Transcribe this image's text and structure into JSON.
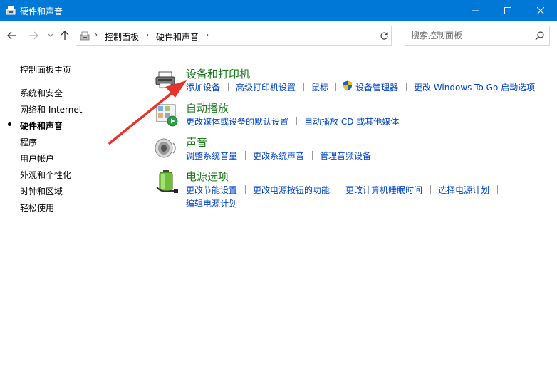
{
  "window": {
    "title": "硬件和声音",
    "controls": {
      "minimize": "minimize-icon",
      "maximize": "maximize-icon",
      "close": "close-icon"
    }
  },
  "address": {
    "breadcrumb": [
      "控制面板",
      "硬件和声音"
    ]
  },
  "search": {
    "placeholder": "搜索控制面板",
    "value": ""
  },
  "sidebar": {
    "home": "控制面板主页",
    "items": [
      {
        "label": "系统和安全",
        "current": false
      },
      {
        "label": "网络和 Internet",
        "current": false
      },
      {
        "label": "硬件和声音",
        "current": true
      },
      {
        "label": "程序",
        "current": false
      },
      {
        "label": "用户帐户",
        "current": false
      },
      {
        "label": "外观和个性化",
        "current": false
      },
      {
        "label": "时钟和区域",
        "current": false
      },
      {
        "label": "轻松使用",
        "current": false
      }
    ]
  },
  "categories": [
    {
      "title": "设备和打印机",
      "icon": "printer-icon",
      "tasks": [
        "添加设备",
        "高级打印机设置",
        "鼠标",
        "设备管理器",
        "更改 Windows To Go 启动选项"
      ]
    },
    {
      "title": "自动播放",
      "icon": "autoplay-icon",
      "tasks": [
        "更改媒体或设备的默认设置",
        "自动播放 CD 或其他媒体"
      ]
    },
    {
      "title": "声音",
      "icon": "speaker-icon",
      "tasks": [
        "调整系统音量",
        "更改系统声音",
        "管理音频设备"
      ]
    },
    {
      "title": "电源选项",
      "icon": "battery-icon",
      "tasks": [
        "更改节能设置",
        "更改电源按钮的功能",
        "更改计算机睡眠时间",
        "选择电源计划",
        "编辑电源计划"
      ]
    }
  ],
  "colors": {
    "titlebar": "#0078d7",
    "category_title": "#1e7a1e",
    "task_link": "#0044cc",
    "annotation_arrow": "#e8322b"
  }
}
